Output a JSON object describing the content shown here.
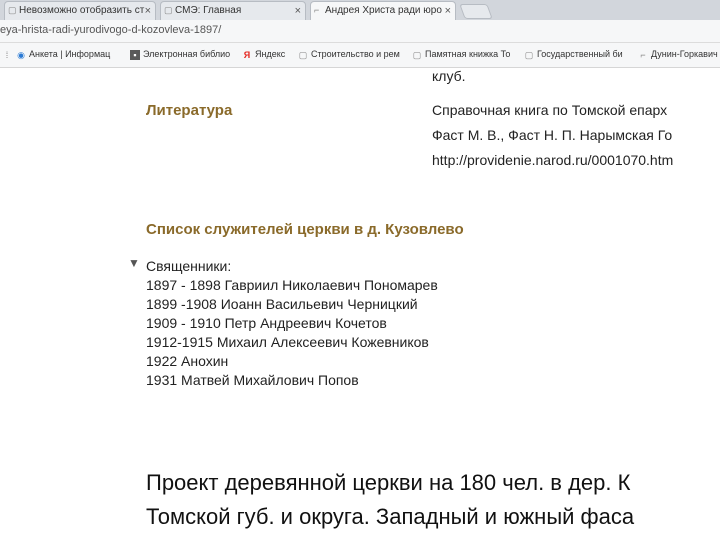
{
  "tabs": [
    {
      "title": "Невозможно отобразить ст",
      "active": false
    },
    {
      "title": "СМЭ: Главная",
      "active": false
    },
    {
      "title": "Андрея Христа ради юро",
      "active": true
    }
  ],
  "address": {
    "url": "eya-hrista-radi-yurodivogo-d-kozovleva-1897/"
  },
  "bookmarks": [
    {
      "label": "Анкета | Информац",
      "icon": "globe-icon"
    },
    {
      "label": "Электронная библио",
      "icon": "library-icon"
    },
    {
      "label": "Яндекс",
      "icon": "yandex-icon"
    },
    {
      "label": "Строительство и рем",
      "icon": "page-icon"
    },
    {
      "label": "Памятная книжка То",
      "icon": "page-icon"
    },
    {
      "label": "Государственный би",
      "icon": "page-icon"
    },
    {
      "label": "Дунин-Горкавич",
      "icon": "page-icon"
    }
  ],
  "page": {
    "club_text": "клуб.",
    "literature_label": "Литература",
    "literature_lines": [
      "Справочная книга по Томской епарх",
      "Фаст М. В., Фаст Н. П. Нарымская Го",
      "http://providenie.narod.ru/0001070.htm"
    ],
    "clergy_heading": "Список служителей церкви в д. Кузовлево",
    "priests_label": "Священники:",
    "priests": [
      "1897 - 1898 Гавриил Николаевич Пономарев",
      "1899 -1908 Иоанн Васильевич Черницкий",
      "1909 - 1910 Петр Андреевич Кочетов",
      "1912-1915 Михаил Алексеевич Кожевников",
      "1922 Анохин",
      "1931 Матвей Михайлович Попов"
    ],
    "project_lines": [
      "Проект деревянной церкви на 180 чел. в дер. К",
      "Томской губ. и округа. Западный и южный фаса"
    ]
  }
}
